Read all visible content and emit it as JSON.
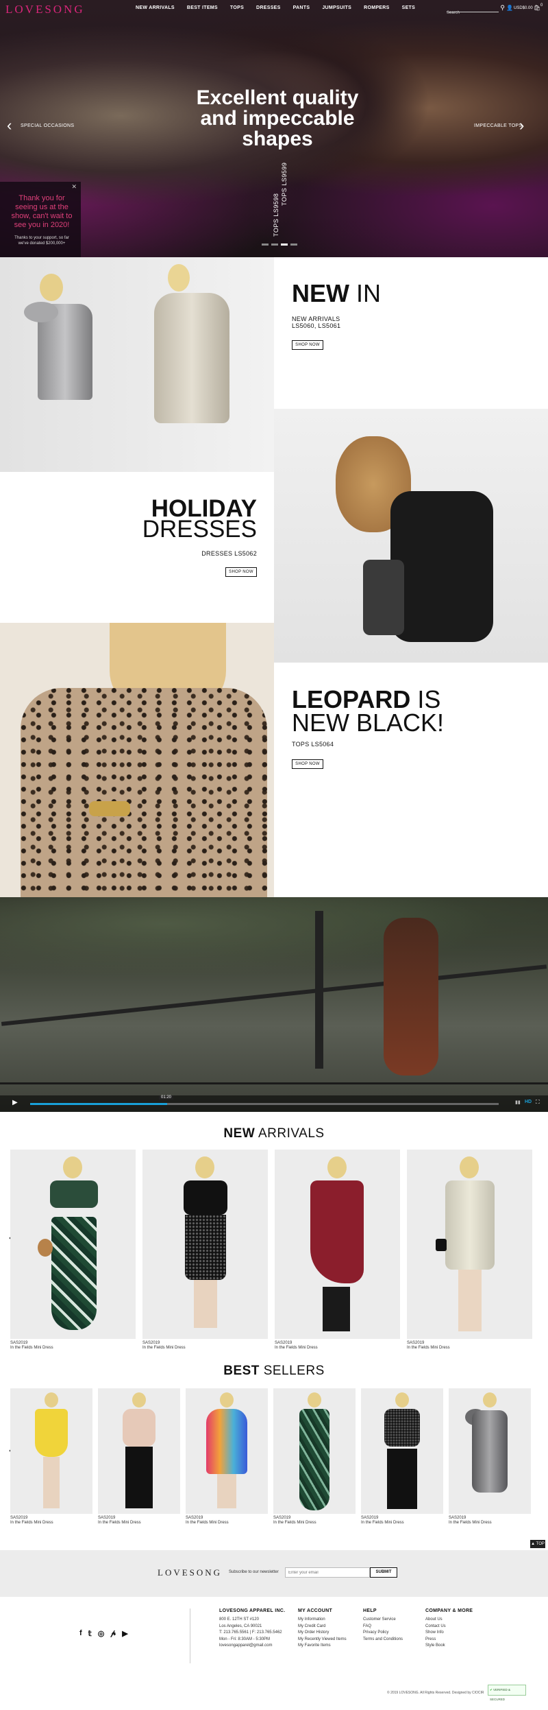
{
  "brand": {
    "name": "LOVESONG",
    "color": "#d9267a"
  },
  "nav": {
    "items": [
      "NEW ARRIVALS",
      "BEST ITEMS",
      "TOPS",
      "DRESSES",
      "PANTS",
      "JUMPSUITS",
      "ROMPERS",
      "SETS"
    ]
  },
  "header": {
    "search_placeholder": "Search",
    "cart_total": "USD$0.00",
    "cart_count": "0"
  },
  "hero": {
    "title_line1": "Excellent quality",
    "title_line2": "and impeccable",
    "title_line3": "shapes",
    "left_label": "SPECIAL OCCASIONS",
    "right_label": "IMPECCABLE TOPS",
    "vertical_1": "TOPS LS9598",
    "vertical_2": "TOPS LS9599",
    "promo_title": "Thank you for seeing us at the show, can't wait to see you in 2020!",
    "promo_sub": "Thanks to your support, so far we've donated $200,000+"
  },
  "block_new": {
    "line1": "NEW",
    "line2": "IN",
    "sub1": "NEW ARRIVALS",
    "sub2": "LS5060, LS5061",
    "button": "SHOP NOW"
  },
  "block_holiday": {
    "line1": "HOLIDAY",
    "line2": "DRESSES",
    "sub": "DRESSES LS5062",
    "button": "SHOP NOW"
  },
  "block_leopard": {
    "line1": "LEOPARD",
    "line1b": "IS",
    "line2": "NEW BLACK!",
    "sub": "TOPS LS5064",
    "button": "SHOP NOW"
  },
  "video": {
    "time": "01:20"
  },
  "new_arrivals": {
    "title_bold": "NEW",
    "title_light": "ARRIVALS",
    "items": [
      {
        "sku": "SAS2019",
        "name": "In the Fields Mini Dress"
      },
      {
        "sku": "SAS2019",
        "name": "In the Fields Mini Dress"
      },
      {
        "sku": "SAS2019",
        "name": "In the Fields Mini Dress"
      },
      {
        "sku": "SAS2019",
        "name": "In the Fields Mini Dress"
      }
    ]
  },
  "best_sellers": {
    "title_bold": "BEST",
    "title_light": "SELLERS",
    "items": [
      {
        "sku": "SAS2019",
        "name": "In the Fields Mini Dress"
      },
      {
        "sku": "SAS2019",
        "name": "In the Fields Mini Dress"
      },
      {
        "sku": "SAS2019",
        "name": "In the Fields Mini Dress"
      },
      {
        "sku": "SAS2019",
        "name": "In the Fields Mini Dress"
      },
      {
        "sku": "SAS2019",
        "name": "In the Fields Mini Dress"
      },
      {
        "sku": "SAS2019",
        "name": "In the Fields Mini Dress"
      }
    ]
  },
  "top_button": "TOP",
  "newsletter": {
    "brand": "LOVESONG",
    "label": "Subscribe to our newsletter",
    "placeholder": "Enter your email",
    "button": "SUBMIT"
  },
  "footer": {
    "company": {
      "title": "LOVESONG APPAREL INC.",
      "lines": [
        "800 E. 12TH ST #120",
        "Los Angeles, CA 90021",
        "T: 213.765.5561 | F: 213.765.5462",
        "Mon - Fri: 8:30AM - 5:30PM",
        "lovesongapparel@gmail.com"
      ]
    },
    "account": {
      "title": "MY ACCOUNT",
      "links": [
        "My Information",
        "My Credit Card",
        "My Order History",
        "My Recently Viewed Items",
        "My Favorite Items"
      ]
    },
    "help": {
      "title": "HELP",
      "links": [
        "Customer Service",
        "FAQ",
        "Privacy Policy",
        "Terms and Conditions"
      ]
    },
    "more": {
      "title": "COMPANY & MORE",
      "links": [
        "About Us",
        "Contact Us",
        "Show Info",
        "Press",
        "Style Book"
      ]
    },
    "copyright": "© 2019 LOVESONG. All Rights Reserved. Designed by CIOCIR",
    "badge": "VERIFIED & SECURED"
  }
}
